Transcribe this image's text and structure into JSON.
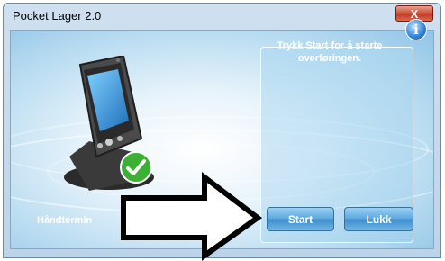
{
  "window": {
    "title": "Pocket Lager 2.0",
    "close_label": "X"
  },
  "panel": {
    "message": "Trykk Start for å starte overføringen.",
    "info_icon": "i"
  },
  "device": {
    "label": "Håndtermin",
    "icon": "pda-device-icon",
    "status_icon": "check-icon"
  },
  "buttons": {
    "start_label": "Start",
    "close_label": "Lukk"
  },
  "colors": {
    "accent": "#3d8ccc",
    "check": "#3cb034",
    "close": "#c23b22"
  }
}
